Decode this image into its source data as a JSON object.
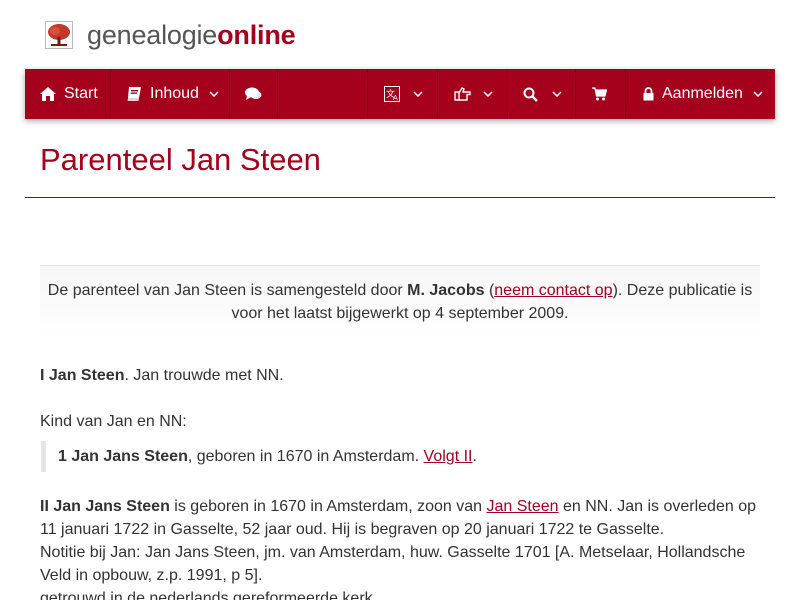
{
  "brand": {
    "part1": "genealogie",
    "part2": "online"
  },
  "nav": {
    "start": "Start",
    "inhoud": "Inhoud",
    "aanmelden": "Aanmelden"
  },
  "page": {
    "title": "Parenteel Jan Steen"
  },
  "intro": {
    "text1": "De parenteel van Jan Steen is samengesteld door ",
    "author": "M. Jacobs",
    "text2": " (",
    "contact_link": "neem contact op",
    "text3": "). Deze publicatie is voor het laatst bijgewerkt op 4 september 2009."
  },
  "gen1": {
    "name": "I Jan Steen",
    "rest": ". Jan trouwde met NN.",
    "children_label": "Kind van Jan en NN:",
    "child_name": "1 Jan Jans Steen",
    "child_rest": ", geboren in 1670 in Amsterdam. ",
    "child_link": "Volgt II",
    "child_end": "."
  },
  "gen2": {
    "name": "II Jan Jans Steen",
    "text1": " is geboren in 1670 in Amsterdam, zoon van ",
    "father_link": "Jan Steen",
    "text2": " en NN. Jan is overleden op 11 januari 1722 in Gasselte, 52 jaar oud. Hij is begraven op 20 januari 1722 te Gasselte.",
    "note": "Notitie bij Jan: Jan Jans Steen, jm. van Amsterdam, huw. Gasselte 1701 [A. Metselaar, Hollandsche Veld in opbouw, z.p. 1991, p 5].",
    "line3": "getrouwd in de nederlands gereformeerde kerk"
  },
  "colors": {
    "brand": "#a5001c",
    "text": "#333333"
  }
}
